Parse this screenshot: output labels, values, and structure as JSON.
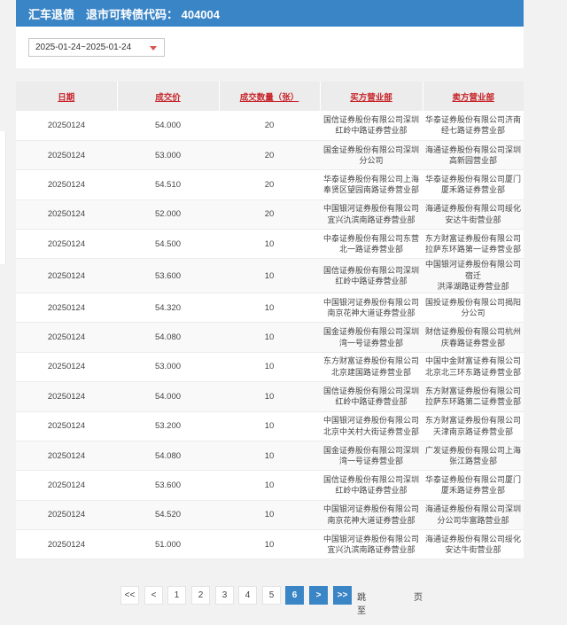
{
  "header": {
    "title": "汇车退债",
    "subtitle": "退市可转债代码： 404004"
  },
  "filter": {
    "date_range": "2025-01-24~2025-01-24"
  },
  "table": {
    "columns": [
      "日期",
      "成交价",
      "成交数量（张）",
      "买方营业部",
      "卖方营业部"
    ],
    "rows": [
      {
        "date": "20250124",
        "price": "54.000",
        "qty": "20",
        "buyer": [
          "国信证券股份有限公司深圳",
          "红岭中路证券营业部"
        ],
        "seller": [
          "华泰证券股份有限公司济南",
          "经七路证券营业部"
        ]
      },
      {
        "date": "20250124",
        "price": "53.000",
        "qty": "20",
        "buyer": [
          "国金证券股份有限公司深圳",
          "分公司"
        ],
        "seller": [
          "海通证券股份有限公司深圳",
          "高新园营业部"
        ]
      },
      {
        "date": "20250124",
        "price": "54.510",
        "qty": "20",
        "buyer": [
          "华泰证券股份有限公司上海",
          "奉贤区望园南路证券营业部"
        ],
        "seller": [
          "华泰证券股份有限公司厦门",
          "厦禾路证券营业部"
        ]
      },
      {
        "date": "20250124",
        "price": "52.000",
        "qty": "20",
        "buyer": [
          "中国银河证券股份有限公司",
          "宜兴氿滨南路证券营业部"
        ],
        "seller": [
          "海通证券股份有限公司绥化",
          "安达牛街营业部"
        ]
      },
      {
        "date": "20250124",
        "price": "54.500",
        "qty": "10",
        "buyer": [
          "中泰证券股份有限公司东营",
          "北一路证券营业部"
        ],
        "seller": [
          "东方财富证券股份有限公司",
          "拉萨东环路第一证券营业部"
        ]
      },
      {
        "date": "20250124",
        "price": "53.600",
        "qty": "10",
        "buyer": [
          "国信证券股份有限公司深圳",
          "红岭中路证券营业部"
        ],
        "seller": [
          "中国银河证券股份有限公司宿迁",
          "洪泽湖路证券营业部"
        ]
      },
      {
        "date": "20250124",
        "price": "54.320",
        "qty": "10",
        "buyer": [
          "中国银河证券股份有限公司",
          "南京花神大道证券营业部"
        ],
        "seller": [
          "国投证券股份有限公司揭阳",
          "分公司"
        ]
      },
      {
        "date": "20250124",
        "price": "54.080",
        "qty": "10",
        "buyer": [
          "国金证券股份有限公司深圳",
          "湾一号证券营业部"
        ],
        "seller": [
          "财信证券股份有限公司杭州",
          "庆春路证券营业部"
        ]
      },
      {
        "date": "20250124",
        "price": "53.000",
        "qty": "10",
        "buyer": [
          "东方财富证券股份有限公司",
          "北京建国路证券营业部"
        ],
        "seller": [
          "中国中金财富证券有限公司",
          "北京北三环东路证券营业部"
        ]
      },
      {
        "date": "20250124",
        "price": "54.000",
        "qty": "10",
        "buyer": [
          "国信证券股份有限公司深圳",
          "红岭中路证券营业部"
        ],
        "seller": [
          "东方财富证券股份有限公司",
          "拉萨东环路第二证券营业部"
        ]
      },
      {
        "date": "20250124",
        "price": "53.200",
        "qty": "10",
        "buyer": [
          "中国银河证券股份有限公司",
          "北京中关村大街证券营业部"
        ],
        "seller": [
          "东方财富证券股份有限公司",
          "天津南京路证券营业部"
        ]
      },
      {
        "date": "20250124",
        "price": "54.080",
        "qty": "10",
        "buyer": [
          "国金证券股份有限公司深圳",
          "湾一号证券营业部"
        ],
        "seller": [
          "广发证券股份有限公司上海",
          "张江路营业部"
        ]
      },
      {
        "date": "20250124",
        "price": "53.600",
        "qty": "10",
        "buyer": [
          "国信证券股份有限公司深圳",
          "红岭中路证券营业部"
        ],
        "seller": [
          "华泰证券股份有限公司厦门",
          "厦禾路证券营业部"
        ]
      },
      {
        "date": "20250124",
        "price": "54.520",
        "qty": "10",
        "buyer": [
          "中国银河证券股份有限公司",
          "南京花神大道证券营业部"
        ],
        "seller": [
          "海通证券股份有限公司深圳",
          "分公司华富路营业部"
        ]
      },
      {
        "date": "20250124",
        "price": "51.000",
        "qty": "10",
        "buyer": [
          "中国银河证券股份有限公司",
          "宜兴氿滨南路证券营业部"
        ],
        "seller": [
          "海通证券股份有限公司绥化",
          "安达牛街营业部"
        ]
      }
    ]
  },
  "pager": {
    "first": "<<",
    "prev": "<",
    "pages": [
      "1",
      "2",
      "3",
      "4",
      "5",
      "6"
    ],
    "current": "6",
    "next": ">",
    "last": ">>",
    "jump_label": "跳至",
    "jump_value": "",
    "jump_unit": "页"
  }
}
